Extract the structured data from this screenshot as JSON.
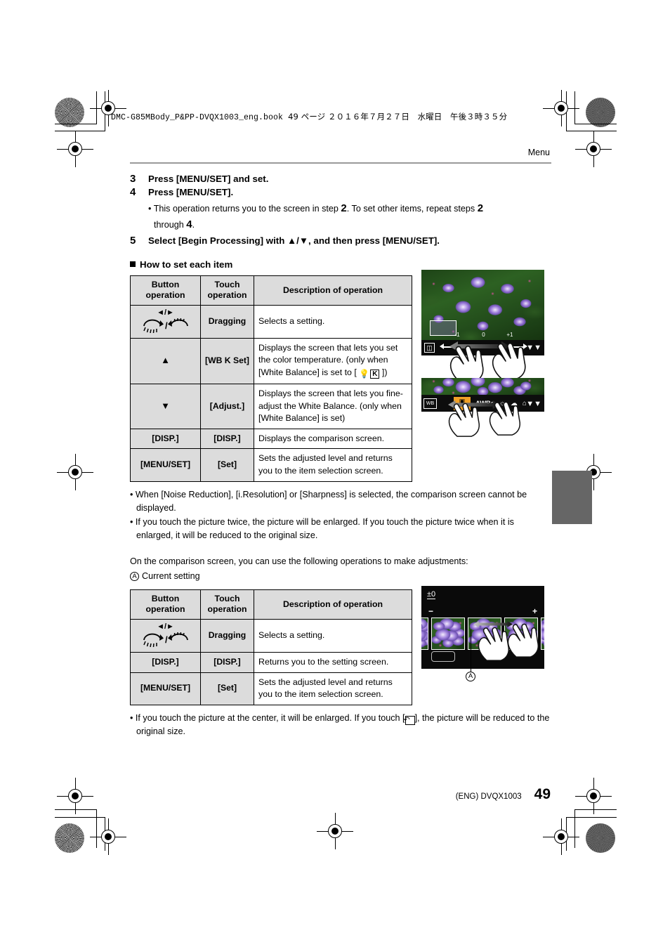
{
  "book_header": {
    "text_ascii": "DMC-G85MBody_P&PP-DVQX1003_eng.book",
    "text_jp": "49 ページ ２０１６年７月２７日　水曜日　午後３時３５分"
  },
  "running_head": "Menu",
  "steps": [
    {
      "num": "3",
      "text": "Press [MENU/SET] and set."
    },
    {
      "num": "4",
      "text": "Press [MENU/SET]."
    },
    {
      "num": "5",
      "text": "Select [Begin Processing] with ▲/▼, and then press [MENU/SET]."
    }
  ],
  "step4_note_a": "This operation returns you to the screen in step ",
  "step4_note_b": ". To set other items, repeat steps ",
  "step4_note_c": "through ",
  "step4_note_refs": {
    "r1": "2",
    "r2": "2",
    "r3": "4"
  },
  "section_heading": "How to set each item",
  "table1": {
    "headers": [
      "Button operation",
      "Touch operation",
      "Description of operation"
    ],
    "rows": [
      {
        "button": "◄/►",
        "button_kind": "dials",
        "touch": "Dragging",
        "desc": "Selects a setting."
      },
      {
        "button": "▲",
        "button_kind": "triangle",
        "touch": "[WB K Set]",
        "desc": "Displays the screen that lets you set the color temperature. (only when [White Balance] is set to [ ",
        "desc_tail": " ])",
        "icon": "wb-kelvin-icon"
      },
      {
        "button": "▼",
        "button_kind": "triangle",
        "touch": "[Adjust.]",
        "desc": "Displays the screen that lets you fine-adjust the White Balance. (only when [White Balance] is set)"
      },
      {
        "button": "[DISP.]",
        "button_kind": "text",
        "touch": "[DISP.]",
        "desc": "Displays the comparison screen."
      },
      {
        "button": "[MENU/SET]",
        "button_kind": "text",
        "touch": "[Set]",
        "desc": "Sets the adjusted level and returns you to the item selection screen."
      }
    ]
  },
  "bullets1": [
    "When [Noise Reduction], [i.Resolution] or [Sharpness] is selected, the comparison screen cannot be displayed.",
    "If you touch the picture twice, the picture will be enlarged. If you touch the picture twice when it is enlarged, it will be reduced to the original size."
  ],
  "comparison_intro": "On the comparison screen, you can use the following operations to make adjustments:",
  "callout_a_label": "A",
  "callout_a_text": "Current setting",
  "table2": {
    "headers": [
      "Button operation",
      "Touch operation",
      "Description of operation"
    ],
    "rows": [
      {
        "button": "◄/►",
        "button_kind": "dials",
        "touch": "Dragging",
        "desc": "Selects a setting."
      },
      {
        "button": "[DISP.]",
        "button_kind": "text",
        "touch": "[DISP.]",
        "desc": "Returns you to the setting screen."
      },
      {
        "button": "[MENU/SET]",
        "button_kind": "text",
        "touch": "[Set]",
        "desc": "Sets the adjusted level and returns you to the item selection screen."
      }
    ]
  },
  "bullet_final_a": "If you touch the picture at the center, it will be enlarged. If you touch [",
  "bullet_final_b": "], the picture will be reduced to the original size.",
  "figures": {
    "exposure_screen": {
      "name": "exposure-adjust-screen",
      "scale_labels": [
        "-1",
        "0",
        "+1"
      ],
      "left_icon": "exposure-compensation-icon",
      "right_icon": "disp-toggle-icon"
    },
    "wb_screen": {
      "name": "white-balance-strip-screen",
      "left_icon": "wb-icon",
      "items": [
        "AWB",
        "AWBc",
        "sun-icon",
        "cloud-icon",
        "shade-icon"
      ],
      "selected": "AWB",
      "selected_color": "#f2a227"
    },
    "comparison_screen": {
      "name": "comparison-screen",
      "current_value": "±0",
      "minus": "−",
      "plus": "+",
      "callout": "A",
      "thumbnail_count": 5
    }
  },
  "footer": {
    "code": "(ENG) DVQX1003",
    "page": "49"
  }
}
